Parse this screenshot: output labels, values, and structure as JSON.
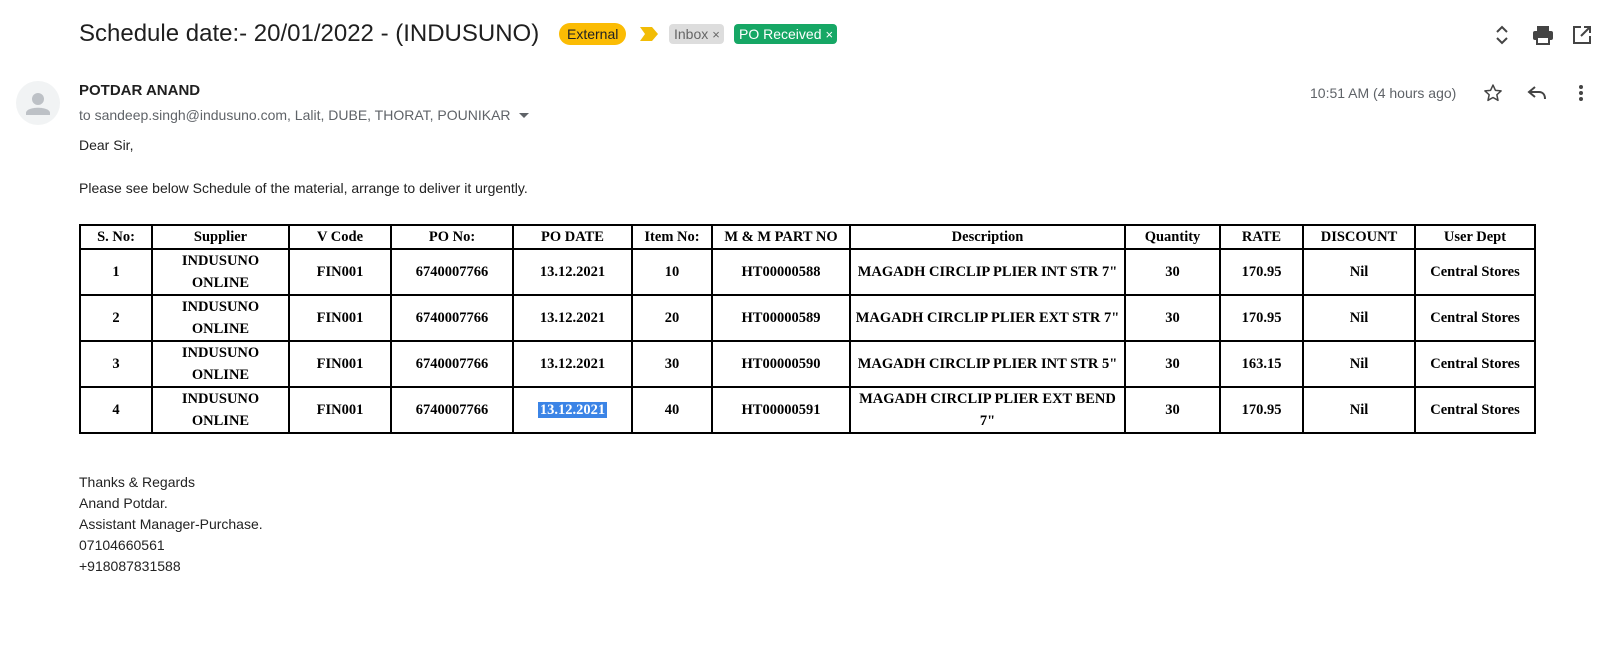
{
  "email": {
    "subject": "Schedule date:- 20/01/2022 - (INDUSUNO)",
    "labels": {
      "external": "External",
      "inbox": "Inbox",
      "po_received": "PO Received",
      "remove": "×"
    },
    "sender": {
      "name": "POTDAR ANAND",
      "recipients": "to sandeep.singh@indusuno.com, Lalit, DUBE, THORAT, POUNIKAR",
      "timestamp": "10:51 AM (4 hours ago)"
    },
    "body": {
      "greeting": "Dear Sir,",
      "message": "Please see below Schedule of the material, arrange to deliver it urgently."
    },
    "table": {
      "headers": [
        "S.  No:",
        "Supplier",
        "V Code",
        "PO No:",
        "PO DATE",
        "Item No:",
        "M & M PART NO",
        "Description",
        "Quantity",
        "RATE",
        "DISCOUNT",
        "User Dept"
      ],
      "rows": [
        [
          "1",
          "INDUSUNO ONLINE",
          "FIN001",
          "6740007766",
          "13.12.2021",
          "10",
          "HT00000588",
          "MAGADH CIRCLIP PLIER INT STR 7\"",
          "30",
          "170.95",
          "Nil",
          "Central Stores"
        ],
        [
          "2",
          "INDUSUNO ONLINE",
          "FIN001",
          "6740007766",
          "13.12.2021",
          "20",
          "HT00000589",
          "MAGADH CIRCLIP PLIER EXT STR 7\"",
          "30",
          "170.95",
          "Nil",
          "Central Stores"
        ],
        [
          "3",
          "INDUSUNO ONLINE",
          "FIN001",
          "6740007766",
          "13.12.2021",
          "30",
          "HT00000590",
          "MAGADH CIRCLIP PLIER INT STR 5\"",
          "30",
          "163.15",
          "Nil",
          "Central Stores"
        ],
        [
          "4",
          "INDUSUNO ONLINE",
          "FIN001",
          "6740007766",
          "13.12.2021",
          "40",
          "HT00000591",
          "MAGADH CIRCLIP PLIER EXT BEND 7\"",
          "30",
          "170.95",
          "Nil",
          "Central Stores"
        ]
      ]
    },
    "signature": {
      "closing": "Thanks & Regards",
      "name": "Anand Potdar.",
      "title": "Assistant Manager-Purchase.",
      "phone1": "07104660561",
      "phone2": "+918087831588"
    }
  },
  "icons": {
    "importance": "importance-marker-icon",
    "expand": "expand-all-icon",
    "print": "print-icon",
    "new_window": "open-in-new-window-icon",
    "avatar": "avatar-icon",
    "star": "star-icon",
    "reply": "reply-icon",
    "more": "more-vert-icon",
    "recipients": "chevron-down-icon"
  },
  "colors": {
    "external_label": "#fbbc04",
    "inbox_label": "#dddddd",
    "po_received_label": "#16a765",
    "importance_marker": "#f2bc06",
    "selection_highlight": "#3b84e6"
  }
}
